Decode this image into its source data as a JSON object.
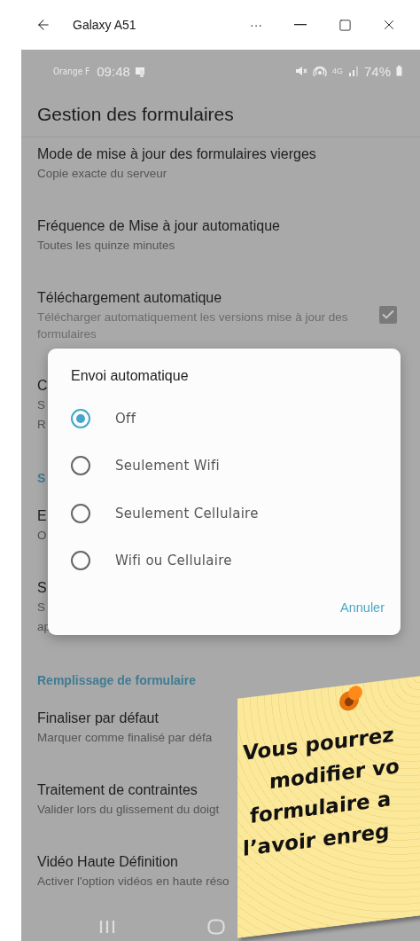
{
  "window": {
    "title": "Galaxy A51",
    "more": "···"
  },
  "status_bar": {
    "carrier": "Orange F",
    "time": "09:48",
    "network": "4G",
    "battery": "74%"
  },
  "screen": {
    "title": "Gestion des formulaires"
  },
  "settings": [
    {
      "kind": "row",
      "title": "Mode de mise à jour des formulaires vierges",
      "summary": [
        "Copie exacte du serveur"
      ]
    },
    {
      "kind": "row",
      "title": "Fréquence de Mise à jour automatique",
      "summary": [
        "Toutes les quinze minutes"
      ]
    },
    {
      "kind": "checkbox",
      "title": "Téléchargement automatique",
      "summary": [
        "Télécharger automatiquement les versions mise à jour des formulaires"
      ],
      "checked": true
    },
    {
      "kind": "row",
      "title": "C",
      "summary": [
        "S",
        "R"
      ]
    },
    {
      "kind": "header",
      "title": "S"
    },
    {
      "kind": "row",
      "title": "E",
      "summary": [
        "O"
      ]
    },
    {
      "kind": "row",
      "title": "S",
      "summary": [
        "S",
        "ap"
      ]
    },
    {
      "kind": "header",
      "title": "Remplissage de formulaire"
    },
    {
      "kind": "row",
      "title": "Finaliser par défaut",
      "summary": [
        "Marquer comme finalisé par défa"
      ]
    },
    {
      "kind": "row",
      "title": "Traitement de contraintes",
      "summary": [
        "Valider lors du glissement du doigt"
      ]
    },
    {
      "kind": "row",
      "title": "Vidéo Haute Définition",
      "summary": [
        "Activer l'option vidéos en haute réso"
      ]
    }
  ],
  "dialog": {
    "title": "Envoi automatique",
    "options": [
      {
        "label": "Off",
        "selected": true
      },
      {
        "label": "Seulement Wifi",
        "selected": false
      },
      {
        "label": "Seulement Cellulaire",
        "selected": false
      },
      {
        "label": "Wifi ou Cellulaire",
        "selected": false
      }
    ],
    "button": "Annuler"
  },
  "note": {
    "lines": [
      "Vous pourrez",
      "modifier vo",
      "formulaire a",
      "l’avoir enreg"
    ]
  }
}
